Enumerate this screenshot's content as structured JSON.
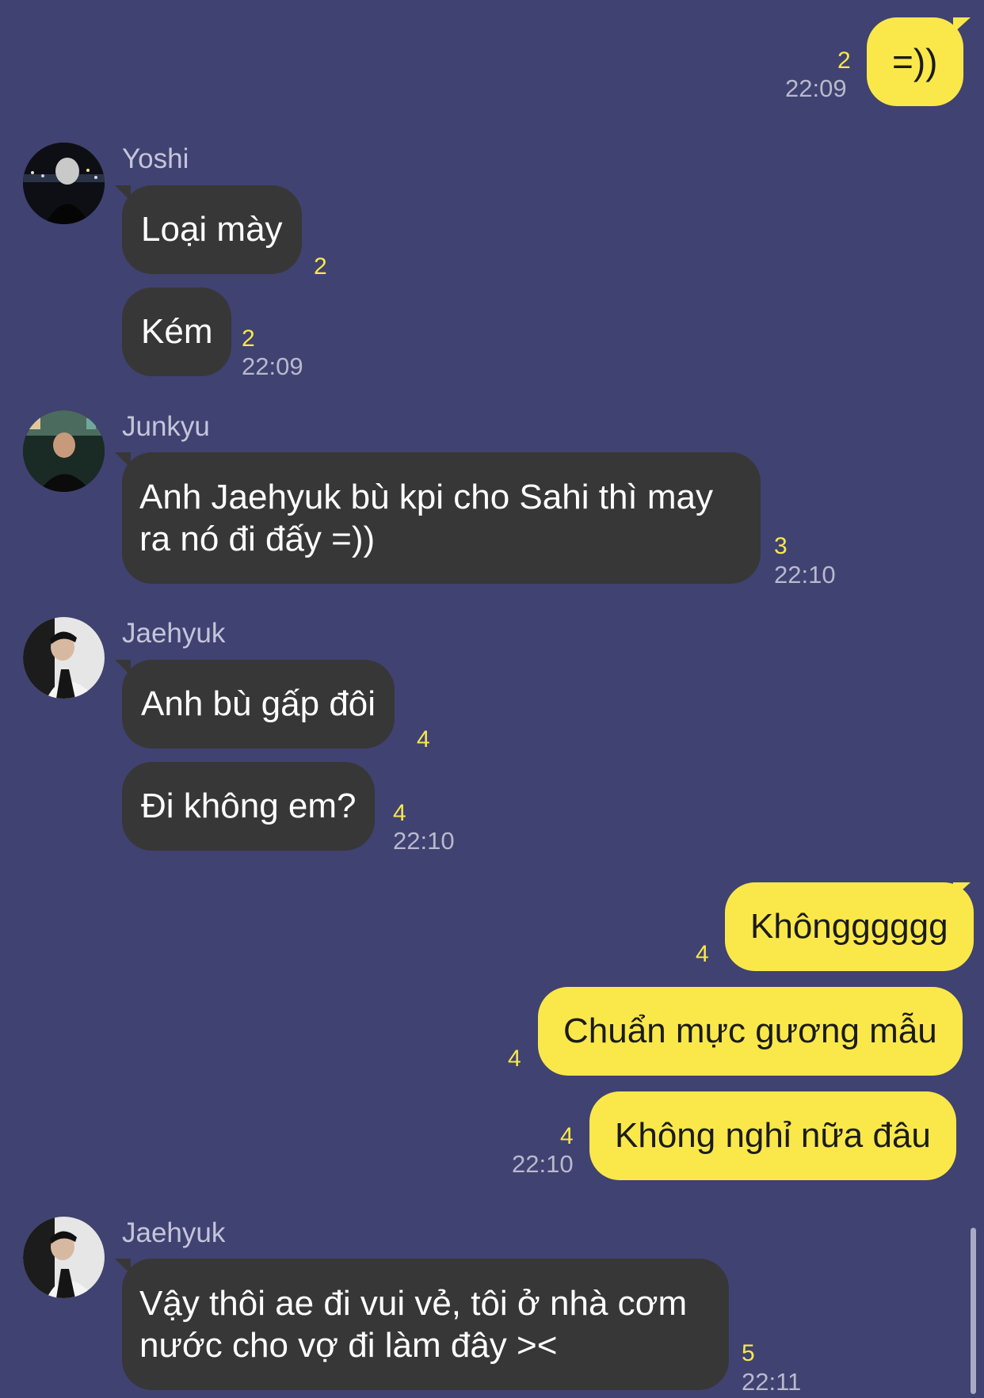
{
  "messages": {
    "m1": {
      "text": "=))",
      "count": "2",
      "time": "22:09"
    },
    "yoshi": {
      "sender": "Yoshi",
      "m1": {
        "text": "Loại mày",
        "count": "2"
      },
      "m2": {
        "text": "Kém",
        "count": "2",
        "time": "22:09"
      }
    },
    "junkyu": {
      "sender": "Junkyu",
      "m1": {
        "text": "Anh Jaehyuk bù kpi cho Sahi thì may ra nó đi đấy =))",
        "count": "3",
        "time": "22:10"
      }
    },
    "jaehyuk1": {
      "sender": "Jaehyuk",
      "m1": {
        "text": "Anh bù gấp đôi",
        "count": "4"
      },
      "m2": {
        "text": "Đi không em?",
        "count": "4",
        "time": "22:10"
      }
    },
    "me2": {
      "m1": {
        "text": "Khôngggggg",
        "count": "4"
      },
      "m2": {
        "text": "Chuẩn mực gương mẫu",
        "count": "4"
      },
      "m3": {
        "text": "Không nghỉ nữa đâu",
        "count": "4",
        "time": "22:10"
      }
    },
    "jaehyuk2": {
      "sender": "Jaehyuk",
      "m1": {
        "text": "Vậy thôi ae đi vui vẻ, tôi ở nhà cơm nước cho vợ đi làm đây ><",
        "count": "5",
        "time": "22:11"
      }
    }
  },
  "icons": {
    "avatar_yoshi": "avatar",
    "avatar_junkyu": "avatar",
    "avatar_jaehyuk": "avatar"
  },
  "colors": {
    "background": "#404271",
    "incoming_bubble": "#373737",
    "outgoing_bubble": "#fae84a",
    "unread_count": "#f7e84b"
  }
}
